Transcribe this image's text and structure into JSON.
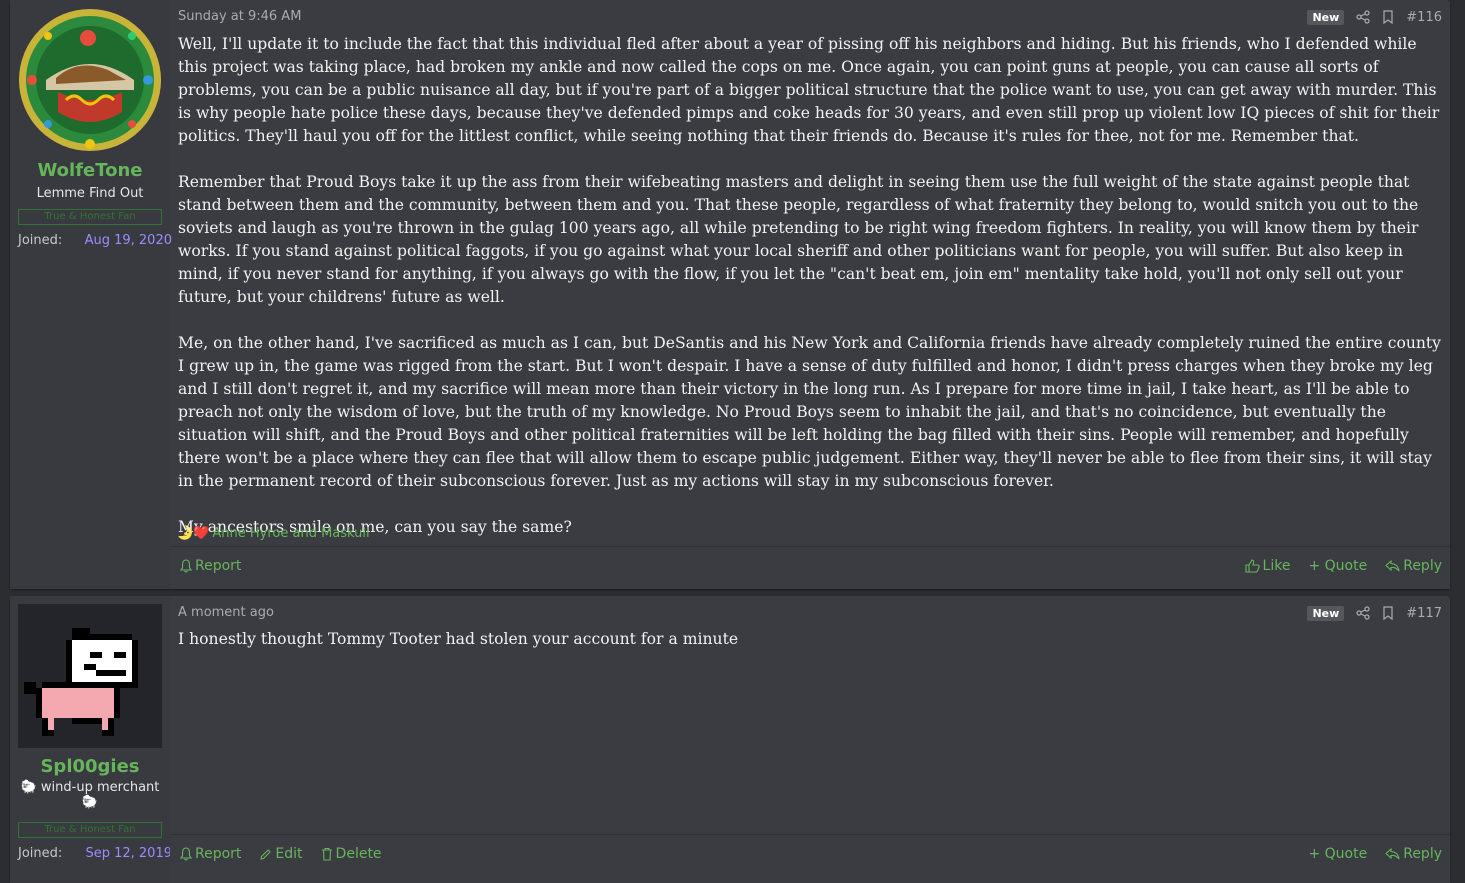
{
  "posts": [
    {
      "user": {
        "name": "WolfeTone",
        "title": "Lemme Find Out",
        "banner": "True & Honest Fan",
        "joined_label": "Joined:",
        "joined_date": "Aug 19, 2020"
      },
      "date": "Sunday at 9:46 AM",
      "badge": "New",
      "number": "#116",
      "paragraphs": [
        "Well, I'll update it to include the fact that this individual fled after about a year of pissing off his neighbors and hiding. But his friends, who I defended while this project was taking place, had broken my ankle and now called the cops on me. Once again, you can point guns at people, you can cause all sorts of problems, you can be a public nuisance all day, but if you're part of a bigger political structure that the police want to use, you can get away with murder. This is why people hate police these days, because they've defended pimps and coke heads for 30 years, and even still prop up violent low IQ pieces of shit for their politics. They'll haul you off for the littlest conflict, while seeing nothing that their friends do. Because it's rules for thee, not for me. Remember that.",
        "Remember that Proud Boys take it up the ass from their wifebeating masters and delight in seeing them use the full weight of the state against people that stand between them and the community, between them and you. That these people, regardless of what fraternity they belong to, would snitch you out to the soviets and laugh as you're thrown in the gulag 100 years ago, all while pretending to be right wing freedom fighters. In reality, you will know them by their works. If you stand against political faggots, if you go against what your local sheriff and other politicians want for people, you will suffer. But also keep in mind, if you never stand for anything, if you always go with the flow, if you let the \"can't beat em, join em\" mentality take hold, you'll not only sell out your future, but your childrens' future as well.",
        "Me, on the other hand, I've sacrificed as much as I can, but DeSantis and his New York and California friends have already completely ruined the entire county I grew up in, the game was rigged from the start. But I won't despair. I have a sense of duty fulfilled and honor, I didn't press charges when they broke my leg and I still don't regret it, and my sacrifice will mean more than their victory in the long run. As I prepare for more time in jail, I take heart, as I'll be able to preach not only the wisdom of love, but the truth of my knowledge. No Proud Boys seem to inhabit the jail, and that's no coincidence, but eventually the situation will shift, and the Proud Boys and other political fraternities will be left holding the bag filled with their sins. People will remember, and hopefully there won't be a place where they can flee that will allow them to escape public judgement. Either way, they'll never be able to flee from their sins, it will stay in the permanent record of their subconscious forever. Just as my actions will stay in my subconscious forever.",
        "My ancestors smile on me, can you say the same?"
      ],
      "reactions": {
        "emoji": "🌛❤️",
        "names": "Anne Hyroe and Maskull"
      },
      "actions_left": [
        "Report"
      ],
      "actions_right": [
        "Like",
        "+ Quote",
        "Reply"
      ]
    },
    {
      "user": {
        "name": "Spl00gies",
        "title_prefix": "🐑",
        "title": "wind-up merchant",
        "title_suffix": "🐑",
        "banner": "True & Honest Fan",
        "joined_label": "Joined:",
        "joined_date": "Sep 12, 2019"
      },
      "date": "A moment ago",
      "badge": "New",
      "number": "#117",
      "paragraphs": [
        "I honestly thought Tommy Tooter had stolen your account for a minute"
      ],
      "actions_left": [
        "Report",
        "Edit",
        "Delete"
      ],
      "actions_right": [
        "+ Quote",
        "Reply"
      ]
    }
  ],
  "colors": {
    "page_bg": "#2b2d31",
    "post_bg": "#3a3c42",
    "accent_green": "#67b55a",
    "date_purple": "#9b8cff"
  }
}
